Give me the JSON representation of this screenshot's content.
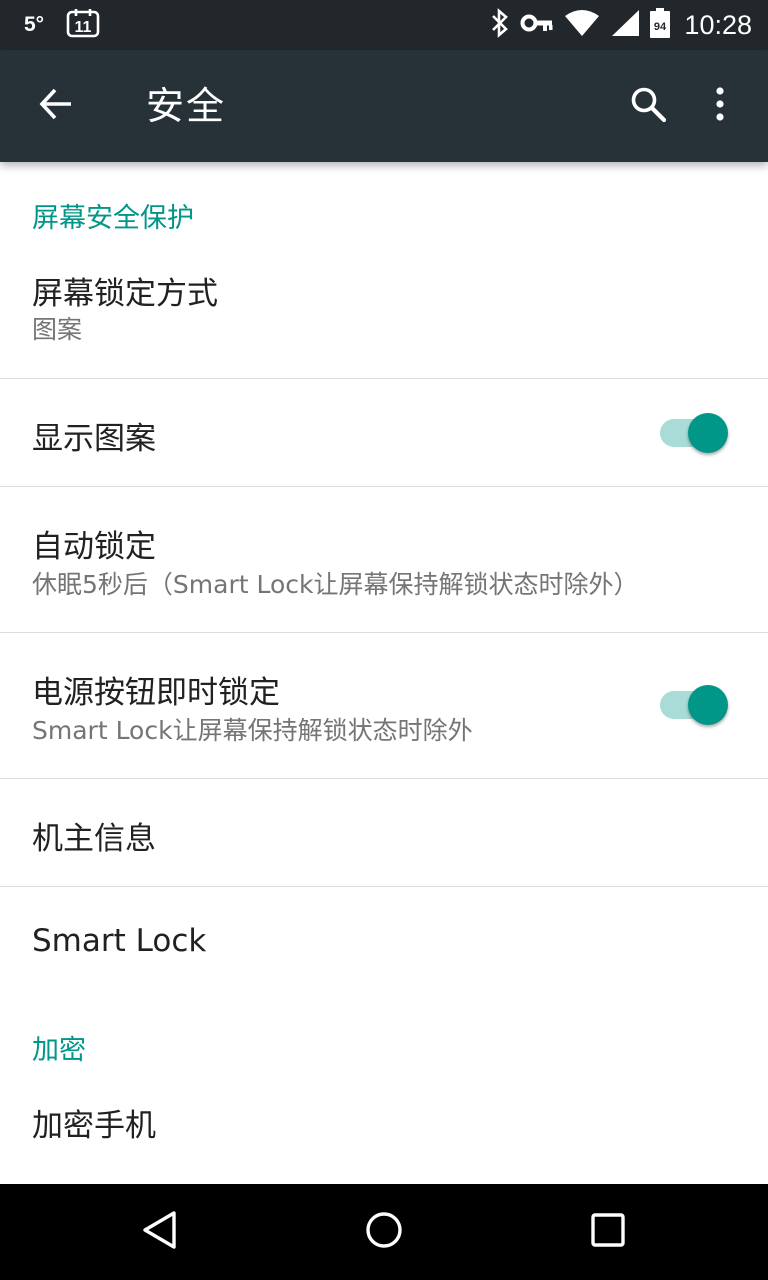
{
  "status_bar": {
    "temperature": "5°",
    "calendar_day": "11",
    "battery_level": "94",
    "time": "10:28"
  },
  "app_bar": {
    "title": "安全"
  },
  "sections": {
    "screen_security": {
      "header": "屏幕安全保护"
    },
    "encryption": {
      "header": "加密"
    }
  },
  "prefs": {
    "screen_lock": {
      "title": "屏幕锁定方式",
      "summary": "图案"
    },
    "show_pattern": {
      "title": "显示图案",
      "enabled": true
    },
    "auto_lock": {
      "title": "自动锁定",
      "summary": "休眠5秒后（Smart Lock让屏幕保持解锁状态时除外）"
    },
    "power_button_lock": {
      "title": "电源按钮即时锁定",
      "summary": "Smart Lock让屏幕保持解锁状态时除外",
      "enabled": true
    },
    "owner_info": {
      "title": "机主信息"
    },
    "smart_lock": {
      "title": "Smart Lock"
    },
    "encrypt_phone": {
      "title": "加密手机"
    }
  },
  "colors": {
    "accent": "#009688",
    "app_bar": "#263238",
    "status_bar": "#21272b",
    "nav_bar": "#000000"
  },
  "icons": {
    "back": "arrow-left-icon",
    "search": "search-icon",
    "more": "more-vert-icon",
    "nav_back": "triangle-back-icon",
    "nav_home": "circle-home-icon",
    "nav_recents": "square-recents-icon"
  }
}
